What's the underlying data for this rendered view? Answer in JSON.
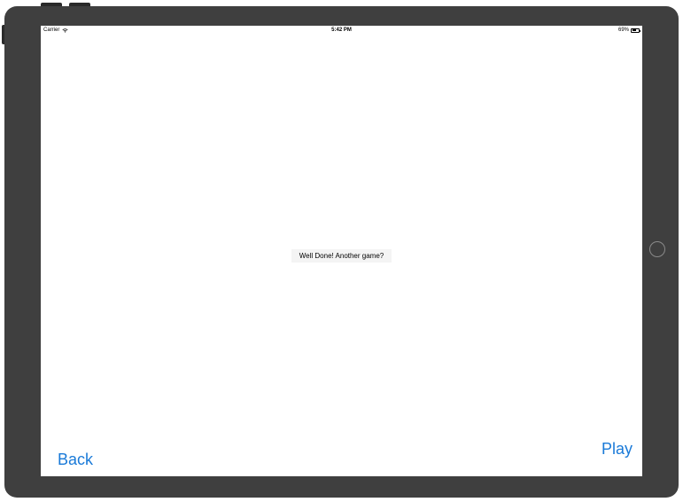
{
  "status_bar": {
    "carrier": "Carrier",
    "wifi_icon": "wifi-icon",
    "time": "5:42 PM",
    "battery_percent_label": "69%",
    "battery_level": 0.69,
    "battery_icon": "battery-icon"
  },
  "main": {
    "message": "Well Done! Another game?"
  },
  "buttons": {
    "back_label": "Back",
    "play_label": "Play"
  },
  "colors": {
    "accent": "#1a7ad8",
    "device_bezel": "#3f3f3f",
    "screen_background": "#ffffff",
    "label_background": "#f4f4f4"
  }
}
